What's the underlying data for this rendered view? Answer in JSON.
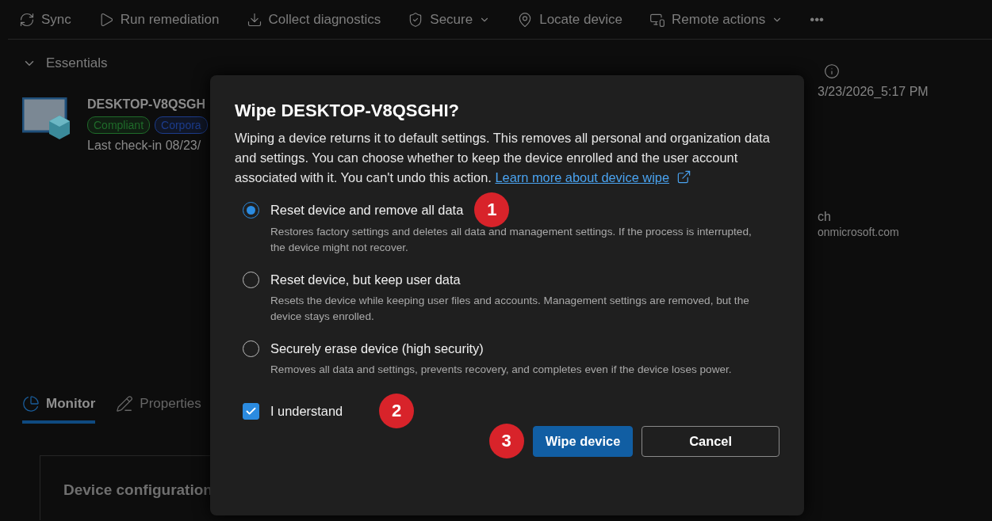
{
  "toolbar": [
    {
      "label": "Sync",
      "kind": "sync",
      "dropdown": false
    },
    {
      "label": "Run remediation",
      "kind": "run",
      "dropdown": false
    },
    {
      "label": "Collect diagnostics",
      "kind": "collect",
      "dropdown": false
    },
    {
      "label": "Secure",
      "kind": "secure",
      "dropdown": true
    },
    {
      "label": "Locate device",
      "kind": "locate",
      "dropdown": false
    },
    {
      "label": "Remote actions",
      "kind": "remote",
      "dropdown": true
    },
    {
      "label": "•••",
      "kind": "more",
      "dropdown": false
    }
  ],
  "essentials": {
    "title": "Essentials",
    "expanded": true,
    "device_name": "DESKTOP-V8QSGH",
    "badges": [
      {
        "label": "Compliant",
        "color": "#1f6b2a"
      },
      {
        "label": "Corpora",
        "color": "#1c3c8c"
      }
    ],
    "last_check_in": "Last check-in 08/23/",
    "right_values": [
      "3/23/2026_5:17 PM",
      "ch",
      "onmicrosoft.com"
    ]
  },
  "tabs": [
    {
      "label": "Monitor",
      "kind": "monitor",
      "selected": true
    },
    {
      "label": "Properties",
      "kind": "properties",
      "selected": false
    }
  ],
  "card": {
    "title": "Device configuration"
  },
  "dialog": {
    "title": "Wipe DESKTOP-V8QSGHI?",
    "body": "Wiping a device returns it to default settings. This removes all personal and organization data and settings. You can choose whether to keep the device enrolled and the user account associated with it. You can't undo this action.",
    "link": "Learn more about device wipe",
    "options": [
      {
        "label": "Reset device and remove all data",
        "description": "Restores factory settings and deletes all data and management settings. If the process is interrupted, the device might not recover.",
        "selected": true,
        "marker": "1"
      },
      {
        "label": "Reset device, but keep user data",
        "description": "Resets the device while keeping user files and accounts. Management settings are removed, but the device stays enrolled.",
        "selected": false
      },
      {
        "label": "Securely erase device (high security)",
        "description": "Removes all data and settings, prevents recovery, and completes even if the device loses power.",
        "selected": false
      }
    ],
    "confirm": {
      "label": "I understand",
      "checked": true,
      "marker": "2"
    },
    "actions_marker": "3",
    "buttons": [
      {
        "label": "Wipe device",
        "kind": "primary"
      },
      {
        "label": "Cancel",
        "kind": "secondary"
      }
    ]
  }
}
